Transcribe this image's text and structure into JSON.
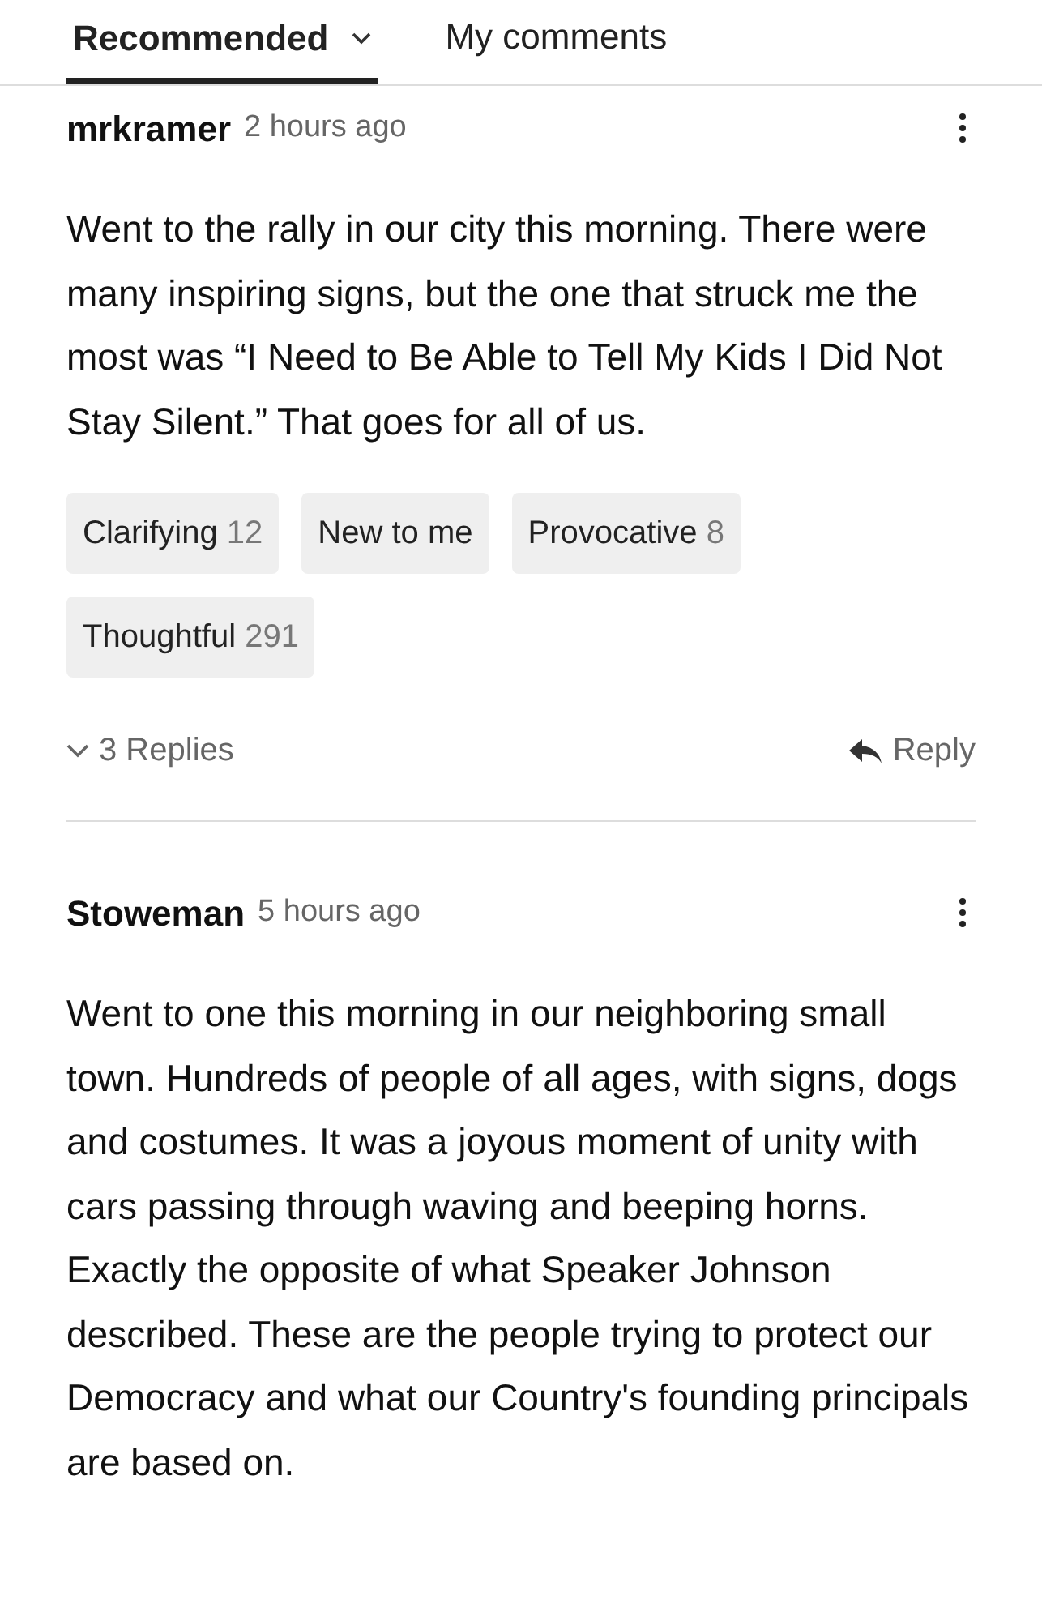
{
  "tabs": [
    {
      "label": "Recommended",
      "selected": true,
      "dropdown": true
    },
    {
      "label": "My comments",
      "selected": false,
      "dropdown": false
    }
  ],
  "comments": [
    {
      "author": "mrkramer",
      "time": "2 hours ago",
      "body": "Went to the rally in our city this morning. There were many inspiring signs, but the one that struck me the most was “I Need to Be Able to Tell My Kids I Did Not Stay Silent.” That goes for all of us.",
      "reactions": [
        {
          "label": "Clarifying",
          "count": "12"
        },
        {
          "label": "New to me"
        },
        {
          "label": "Provocative",
          "count": "8"
        },
        {
          "label": "Thoughtful",
          "count": "291"
        }
      ],
      "replies": "3 Replies",
      "reply": "Reply"
    },
    {
      "author": "Stoweman",
      "time": "5 hours ago",
      "body": "Went to one this morning in our neighboring small town. Hundreds of people of all ages, with signs, dogs and costumes. It was a joyous moment of unity with cars passing through waving and beeping horns. Exactly the opposite of what Speaker Johnson described. These are the people trying to protect our Democracy and what our Country's founding principals are based on."
    }
  ]
}
